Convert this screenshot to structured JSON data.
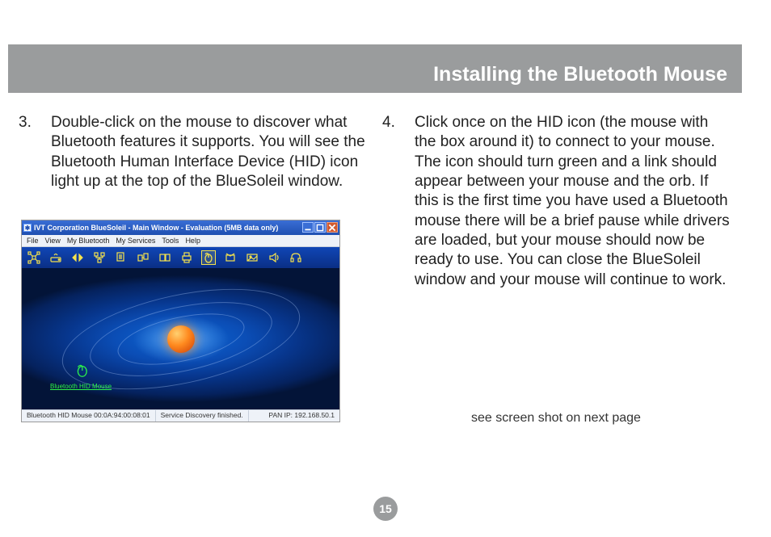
{
  "header": {
    "title": "Installing the Bluetooth Mouse"
  },
  "page_number": "15",
  "left": {
    "step_num": "3.",
    "step_text": "Double-click on the mouse to discover what Bluetooth features it supports. You will see the Bluetooth Human Interface Device (HID) icon light up at the top of the BlueSoleil window."
  },
  "right": {
    "step_num": "4.",
    "step_text": "Click once on the HID icon (the mouse with the box around it) to connect to your mouse.  The icon should turn green and a link should appear between your mouse and the orb.  If this is the first time you have used a Bluetooth mouse there will be a brief pause while drivers are loaded, but your mouse should now be ready to use. You can close the BlueSoleil window and your mouse will continue to work.",
    "note": "see screen shot on next page"
  },
  "screenshot": {
    "title": "IVT Corporation BlueSoleil - Main Window - Evaluation (5MB data only)",
    "menu": [
      "File",
      "View",
      "My Bluetooth",
      "My Services",
      "Tools",
      "Help"
    ],
    "device_label": "Bluetooth HID Mouse",
    "status": {
      "left": "Bluetooth HID Mouse  00:0A:94:00:08:01",
      "center": "Service Discovery finished.",
      "right": "PAN IP: 192.168.50.1"
    }
  }
}
